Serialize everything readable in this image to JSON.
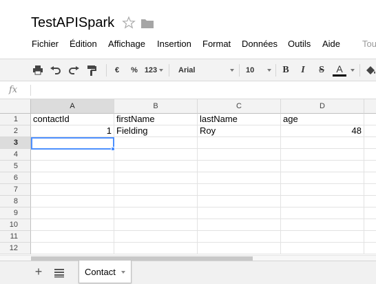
{
  "document": {
    "title": "TestAPISpark"
  },
  "menu": [
    "Fichier",
    "Édition",
    "Affichage",
    "Insertion",
    "Format",
    "Données",
    "Outils",
    "Aide",
    "Tou"
  ],
  "toolbar": {
    "currency": "€",
    "percent": "%",
    "number_format": "123",
    "font": "Arial",
    "font_size": "10",
    "bold": "B",
    "italic": "I",
    "strike": "S",
    "text_color": "A",
    "text_color_swatch": "#000000"
  },
  "formula_bar": {
    "icon": "fx",
    "value": ""
  },
  "grid": {
    "columns": [
      "A",
      "B",
      "C",
      "D"
    ],
    "rows": [
      "1",
      "2",
      "3",
      "4",
      "5",
      "6",
      "7",
      "8",
      "9",
      "10",
      "11",
      "12"
    ],
    "cells": [
      [
        "contactId",
        "firstName",
        "lastName",
        "age"
      ],
      [
        "1",
        "Fielding",
        "Roy",
        "48"
      ]
    ],
    "active_cell": "A3",
    "selection_color": "#4d90fe"
  },
  "sheets": {
    "tabs": [
      "Contact"
    ]
  }
}
